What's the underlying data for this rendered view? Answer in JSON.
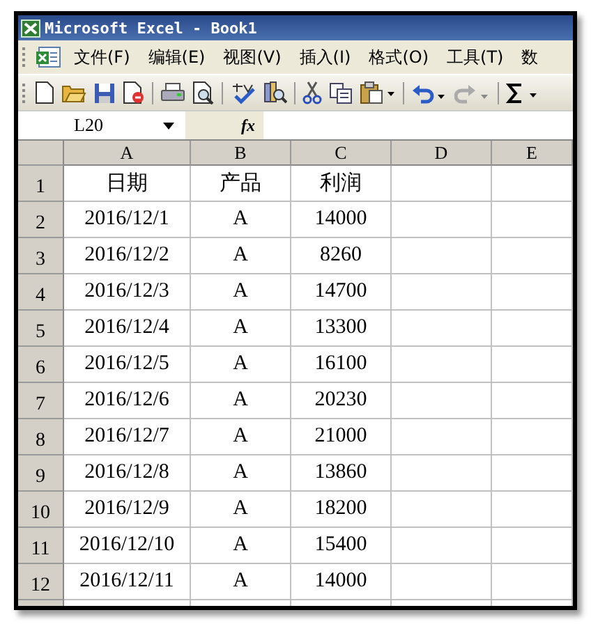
{
  "window": {
    "title": "Microsoft Excel - Book1"
  },
  "menu": [
    {
      "label": "文件(F)"
    },
    {
      "label": "编辑(E)"
    },
    {
      "label": "视图(V)"
    },
    {
      "label": "插入(I)"
    },
    {
      "label": "格式(O)"
    },
    {
      "label": "工具(T)"
    },
    {
      "label": "数"
    }
  ],
  "formula_bar": {
    "name_box": "L20",
    "fx": "fx"
  },
  "columns": [
    "A",
    "B",
    "C",
    "D",
    "E"
  ],
  "rows": [
    {
      "header": "1",
      "cells": [
        "日期",
        "产品",
        "利润"
      ]
    },
    {
      "header": "2",
      "cells": [
        "2016/12/1",
        "A",
        "14000"
      ]
    },
    {
      "header": "3",
      "cells": [
        "2016/12/2",
        "A",
        "8260"
      ]
    },
    {
      "header": "4",
      "cells": [
        "2016/12/3",
        "A",
        "14700"
      ]
    },
    {
      "header": "5",
      "cells": [
        "2016/12/4",
        "A",
        "13300"
      ]
    },
    {
      "header": "6",
      "cells": [
        "2016/12/5",
        "A",
        "16100"
      ]
    },
    {
      "header": "7",
      "cells": [
        "2016/12/6",
        "A",
        "20230"
      ]
    },
    {
      "header": "8",
      "cells": [
        "2016/12/7",
        "A",
        "21000"
      ]
    },
    {
      "header": "9",
      "cells": [
        "2016/12/8",
        "A",
        "13860"
      ]
    },
    {
      "header": "10",
      "cells": [
        "2016/12/9",
        "A",
        "18200"
      ]
    },
    {
      "header": "11",
      "cells": [
        "2016/12/10",
        "A",
        "15400"
      ]
    },
    {
      "header": "12",
      "cells": [
        "2016/12/11",
        "A",
        "14000"
      ]
    }
  ]
}
